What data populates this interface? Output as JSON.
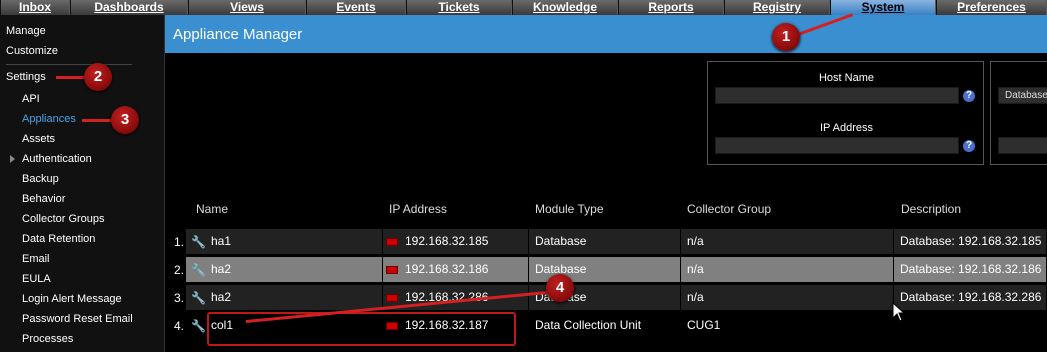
{
  "tabs": [
    {
      "label": "Inbox"
    },
    {
      "label": "Dashboards"
    },
    {
      "label": "Views"
    },
    {
      "label": "Events"
    },
    {
      "label": "Tickets"
    },
    {
      "label": "Knowledge"
    },
    {
      "label": "Reports"
    },
    {
      "label": "Registry"
    },
    {
      "label": "System",
      "active": true
    },
    {
      "label": "Preferences"
    }
  ],
  "sidebar": {
    "top": [
      "Manage",
      "Customize"
    ],
    "settings": "Settings",
    "items": [
      "API",
      "Appliances",
      "Assets",
      "Authentication",
      "Backup",
      "Behavior",
      "Collector Groups",
      "Data Retention",
      "Email",
      "EULA",
      "Login Alert Message",
      "Password Reset Email",
      "Processes"
    ],
    "active": "Appliances"
  },
  "title": "Appliance Manager",
  "filters": {
    "host_name_label": "Host Name",
    "ip_address_label": "IP Address",
    "module_type_value": "Database",
    "help_glyph": "?"
  },
  "table": {
    "headers": [
      "Name",
      "IP Address",
      "Module Type",
      "Collector Group",
      "Description"
    ],
    "rows": [
      {
        "num": "1.",
        "name": "ha1",
        "ip": "192.168.32.185",
        "type": "Database",
        "group": "n/a",
        "desc": "Database: 192.168.32.185"
      },
      {
        "num": "2.",
        "name": "ha2",
        "ip": "192.168.32.186",
        "type": "Database",
        "group": "n/a",
        "desc": "Database: 192.168.32.186"
      },
      {
        "num": "3.",
        "name": "ha2",
        "ip": "192.168.32.286",
        "type": "Database",
        "group": "n/a",
        "desc": "Database: 192.168.32.286"
      },
      {
        "num": "4.",
        "name": "col1",
        "ip": "192.168.32.187",
        "type": "Data Collection Unit",
        "group": "CUG1",
        "desc": ""
      }
    ]
  },
  "annotations": {
    "b1": "1",
    "b2": "2",
    "b3": "3",
    "b4": "4"
  },
  "colors": {
    "accent": "#3a8fd1",
    "annotation": "#c01818"
  }
}
